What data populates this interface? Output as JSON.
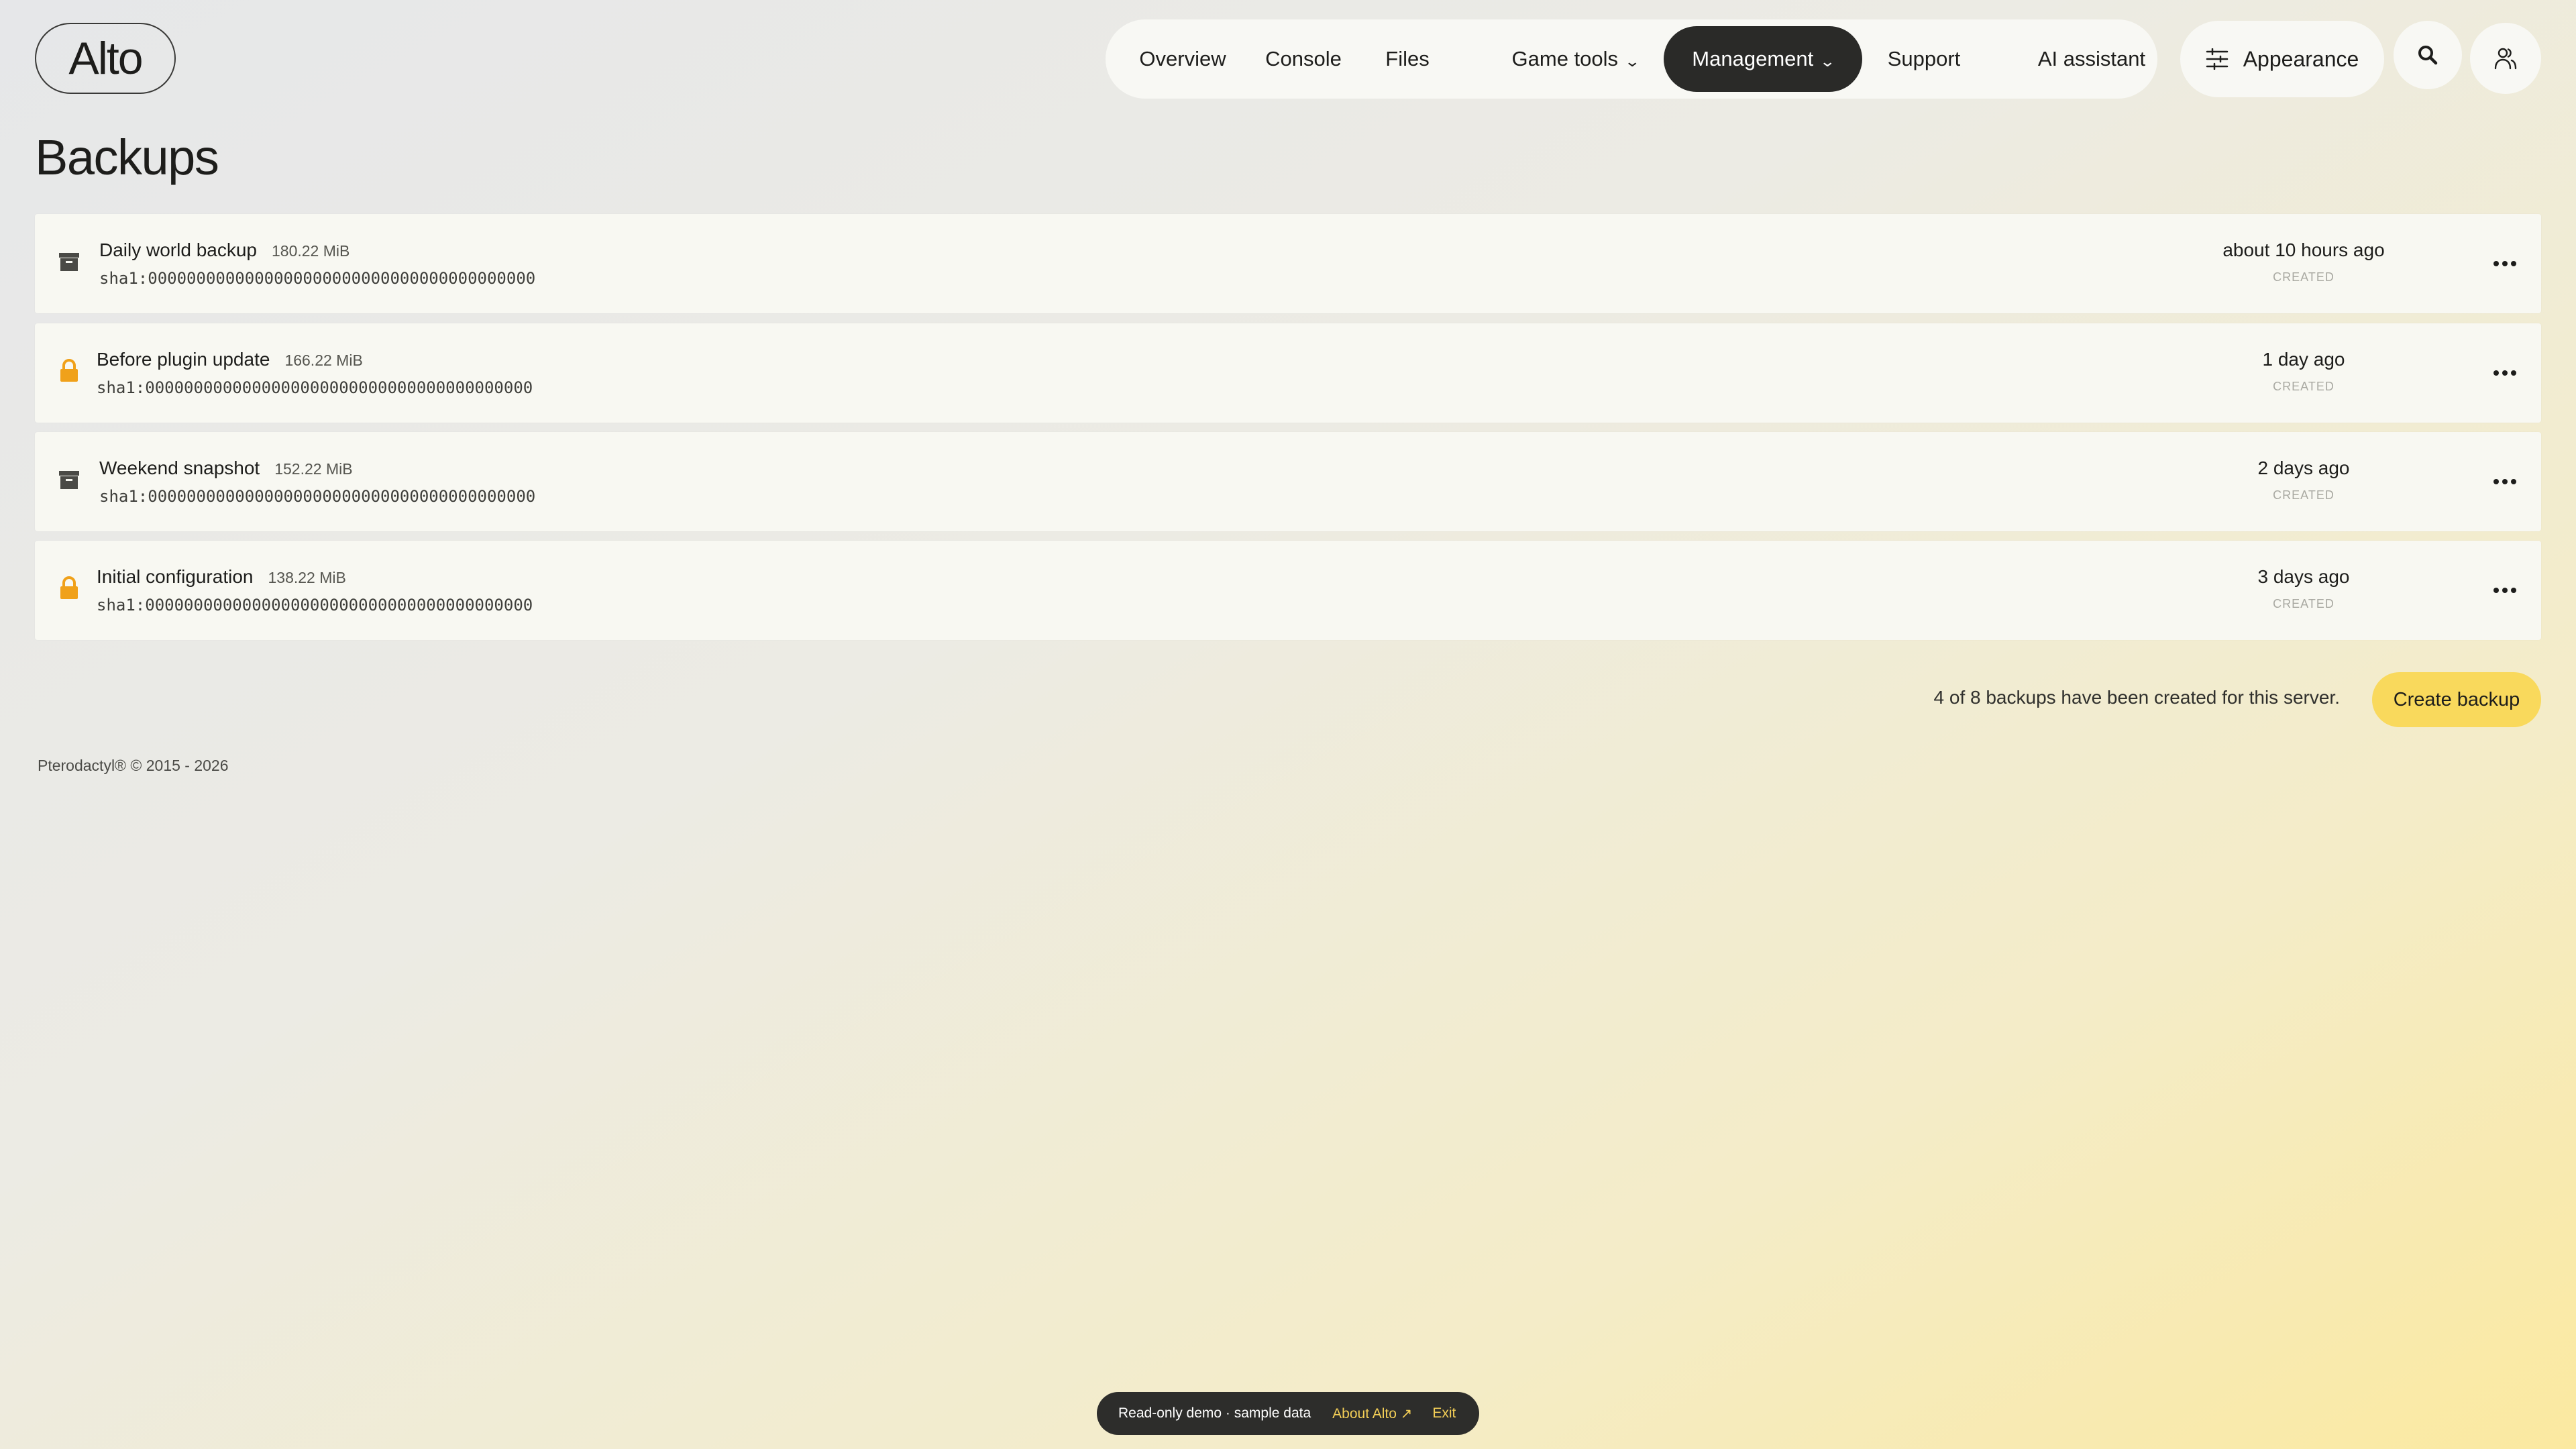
{
  "brand": {
    "logo_text": "Alto"
  },
  "nav": {
    "items": [
      {
        "label": "Overview"
      },
      {
        "label": "Console"
      },
      {
        "label": "Files"
      },
      {
        "label": "Game tools",
        "has_dropdown": true
      },
      {
        "label": "Management",
        "has_dropdown": true,
        "active": true
      },
      {
        "label": "Support"
      },
      {
        "label": "AI assistant"
      }
    ],
    "appearance_label": "Appearance",
    "search_icon": "search-icon",
    "account_icon": "users-icon"
  },
  "page": {
    "title": "Backups"
  },
  "backups": [
    {
      "name": "Daily world backup",
      "size": "180.22 MiB",
      "hash": "sha1:0000000000000000000000000000000000000000",
      "time": "about 10 hours ago",
      "created_label": "CREATED",
      "locked": false,
      "icon": "archive-icon"
    },
    {
      "name": "Before plugin update",
      "size": "166.22 MiB",
      "hash": "sha1:0000000000000000000000000000000000000000",
      "time": "1 day ago",
      "created_label": "CREATED",
      "locked": true,
      "icon": "lock-icon"
    },
    {
      "name": "Weekend snapshot",
      "size": "152.22 MiB",
      "hash": "sha1:0000000000000000000000000000000000000000",
      "time": "2 days ago",
      "created_label": "CREATED",
      "locked": false,
      "icon": "archive-icon"
    },
    {
      "name": "Initial configuration",
      "size": "138.22 MiB",
      "hash": "sha1:0000000000000000000000000000000000000000",
      "time": "3 days ago",
      "created_label": "CREATED",
      "locked": true,
      "icon": "lock-icon"
    }
  ],
  "summary": {
    "text": "4 of 8 backups have been created for this server.",
    "create_label": "Create backup"
  },
  "footer": {
    "text": "Pterodactyl® © 2015 - 2026"
  },
  "demo_bar": {
    "text": "Read-only demo · sample data",
    "about_label": "About Alto ↗",
    "exit_label": "Exit"
  },
  "colors": {
    "accent": "#f9d95c",
    "dark": "#2a2a28",
    "lock": "#f0a11a",
    "panel": "#f8f8f2"
  }
}
